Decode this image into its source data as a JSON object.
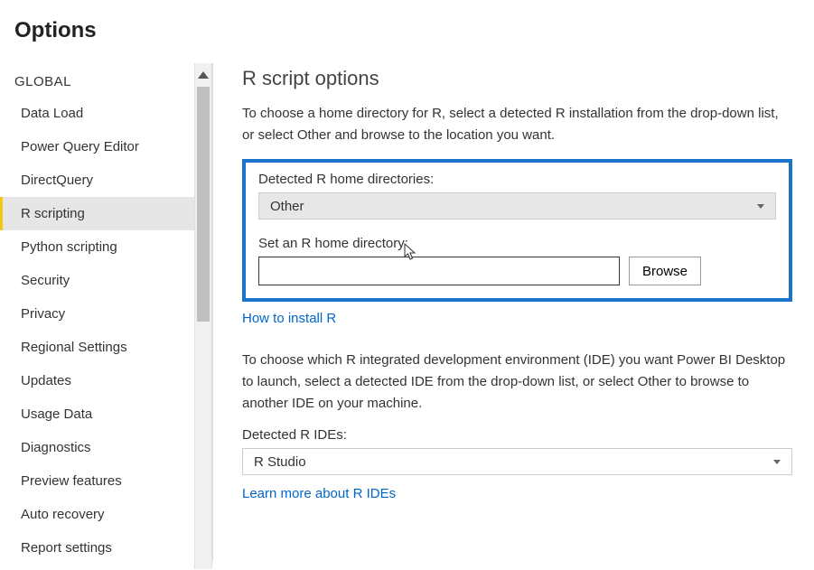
{
  "dialog": {
    "title": "Options"
  },
  "sidebar": {
    "section_heading": "GLOBAL",
    "items": [
      {
        "label": "Data Load",
        "active": false
      },
      {
        "label": "Power Query Editor",
        "active": false
      },
      {
        "label": "DirectQuery",
        "active": false
      },
      {
        "label": "R scripting",
        "active": true
      },
      {
        "label": "Python scripting",
        "active": false
      },
      {
        "label": "Security",
        "active": false
      },
      {
        "label": "Privacy",
        "active": false
      },
      {
        "label": "Regional Settings",
        "active": false
      },
      {
        "label": "Updates",
        "active": false
      },
      {
        "label": "Usage Data",
        "active": false
      },
      {
        "label": "Diagnostics",
        "active": false
      },
      {
        "label": "Preview features",
        "active": false
      },
      {
        "label": "Auto recovery",
        "active": false
      },
      {
        "label": "Report settings",
        "active": false
      }
    ]
  },
  "content": {
    "title": "R script options",
    "intro": "To choose a home directory for R, select a detected R installation from the drop-down list, or select Other and browse to the location you want.",
    "detected_home_label": "Detected R home directories:",
    "detected_home_value": "Other",
    "set_home_label": "Set an R home directory:",
    "set_home_value": "",
    "browse_label": "Browse",
    "install_link": "How to install R",
    "ide_intro": "To choose which R integrated development environment (IDE) you want Power BI Desktop to launch, select a detected IDE from the drop-down list, or select Other to browse to another IDE on your machine.",
    "detected_ide_label": "Detected R IDEs:",
    "detected_ide_value": "R Studio",
    "ide_link": "Learn more about R IDEs"
  }
}
